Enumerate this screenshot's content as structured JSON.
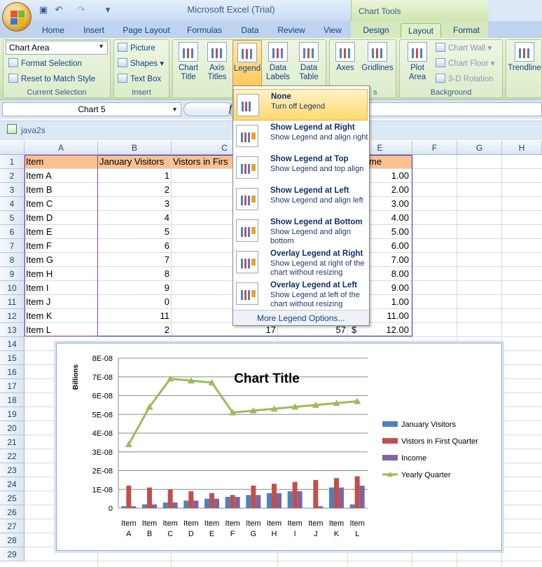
{
  "app": {
    "title": "Microsoft Excel (Trial)",
    "contextual_group": "Chart Tools"
  },
  "tabs": [
    "Home",
    "Insert",
    "Page Layout",
    "Formulas",
    "Data",
    "Review",
    "View",
    "Design",
    "Layout",
    "Format"
  ],
  "active_tab": "Layout",
  "ribbon": {
    "current_selection": {
      "dropdown_value": "Chart Area",
      "format_selection": "Format Selection",
      "reset_style": "Reset to Match Style",
      "label": "Current Selection"
    },
    "insert": {
      "picture": "Picture",
      "shapes": "Shapes",
      "text_box": "Text Box",
      "label": "Insert"
    },
    "labels_group": {
      "chart_title": "Chart Title",
      "axis_titles": "Axis Titles",
      "legend": "Legend",
      "data_labels": "Data Labels",
      "data_table": "Data Table"
    },
    "axes_group": {
      "axes": "Axes",
      "gridlines": "Gridlines",
      "label_tail": "s"
    },
    "background": {
      "plot_area": "Plot Area",
      "chart_wall": "Chart Wall",
      "chart_floor": "Chart Floor",
      "rotation": "3-D Rotation",
      "label": "Background"
    },
    "analysis": {
      "trendline": "Trendline"
    }
  },
  "formula_bar": {
    "name_box": "Chart 5",
    "fx": "f"
  },
  "workbook": {
    "name": "java2s",
    "columns": [
      "A",
      "B",
      "C",
      "D",
      "E",
      "F",
      "G",
      "H"
    ],
    "rows": [
      "1",
      "2",
      "3",
      "4",
      "5",
      "6",
      "7",
      "8",
      "9",
      "10",
      "11",
      "12",
      "13",
      "14",
      "15",
      "16",
      "17",
      "18",
      "19",
      "20",
      "21",
      "22",
      "23",
      "24",
      "25",
      "26",
      "27",
      "28",
      "29"
    ],
    "header": {
      "a": "Item",
      "b": "January Visitors",
      "c": "Vistors in Firs",
      "e": "me"
    },
    "data_rows": [
      {
        "item": "Item A",
        "jan": "1",
        "inc": "1.00"
      },
      {
        "item": "Item B",
        "jan": "2",
        "inc": "2.00"
      },
      {
        "item": "Item C",
        "jan": "3",
        "inc": "3.00"
      },
      {
        "item": "Item D",
        "jan": "4",
        "inc": "4.00"
      },
      {
        "item": "Item E",
        "jan": "5",
        "inc": "5.00"
      },
      {
        "item": "Item F",
        "jan": "6",
        "inc": "6.00"
      },
      {
        "item": "Item G",
        "jan": "7",
        "inc": "7.00"
      },
      {
        "item": "Item H",
        "jan": "8",
        "inc": "8.00"
      },
      {
        "item": "Item I",
        "jan": "9",
        "inc": "9.00"
      },
      {
        "item": "Item J",
        "jan": "0",
        "inc": "1.00"
      },
      {
        "item": "Item K",
        "jan": "11",
        "inc": "11.00"
      },
      {
        "item": "Item L",
        "jan": "2",
        "inc": "12.00"
      }
    ],
    "row13_extra": {
      "c": "17",
      "d": "57",
      "currency": "$"
    }
  },
  "legend_menu": {
    "items": [
      {
        "title": "None",
        "desc": "Turn off Legend"
      },
      {
        "title": "Show Legend at Right",
        "desc": "Show Legend and align right"
      },
      {
        "title": "Show Legend at Top",
        "desc": "Show Legend and top align"
      },
      {
        "title": "Show Legend at Left",
        "desc": "Show Legend and align left"
      },
      {
        "title": "Show Legend at Bottom",
        "desc": "Show Legend and align bottom"
      },
      {
        "title": "Overlay Legend at Right",
        "desc": "Show Legend at right of the chart without resizing"
      },
      {
        "title": "Overlay Legend at Left",
        "desc": "Show Legend at left of the chart without resizing"
      }
    ],
    "more": "More Legend Options..."
  },
  "colors": {
    "jan": "#4f81bd",
    "vis": "#c0504d",
    "inc": "#8064a2",
    "yearly": "#9bbb59"
  },
  "chart_data": {
    "type": "bar",
    "title": "Chart Title",
    "ylabel": "Billions",
    "ylim": [
      0,
      8e-08
    ],
    "yticks": [
      "0",
      "1E-08",
      "2E-08",
      "3E-08",
      "4E-08",
      "5E-08",
      "6E-08",
      "7E-08",
      "8E-08"
    ],
    "categories": [
      [
        "Item",
        "A"
      ],
      [
        "Item",
        "B"
      ],
      [
        "Item",
        "C"
      ],
      [
        "Item",
        "D"
      ],
      [
        "Item",
        "E"
      ],
      [
        "Item",
        "F"
      ],
      [
        "Item",
        "G"
      ],
      [
        "Item",
        "H"
      ],
      [
        "Item",
        "I"
      ],
      [
        "Item",
        "J"
      ],
      [
        "Item",
        "K"
      ],
      [
        "Item",
        "L"
      ]
    ],
    "series": [
      {
        "name": "January Visitors",
        "type": "bar",
        "values": [
          1e-09,
          2e-09,
          3e-09,
          4e-09,
          5e-09,
          6e-09,
          7e-09,
          8e-09,
          9e-09,
          0,
          1.1e-08,
          2e-09
        ]
      },
      {
        "name": "Vistors in First Quarter",
        "type": "bar",
        "values": [
          1.2e-08,
          1.1e-08,
          1e-08,
          9e-09,
          8e-09,
          7e-09,
          1.2e-08,
          1.3e-08,
          1.4e-08,
          1.5e-08,
          1.6e-08,
          1.7e-08
        ]
      },
      {
        "name": "Income",
        "type": "bar",
        "values": [
          1e-09,
          2e-09,
          3e-09,
          4e-09,
          5e-09,
          6e-09,
          7e-09,
          8e-09,
          9e-09,
          1e-09,
          1.1e-08,
          1.2e-08
        ]
      },
      {
        "name": "Yearly Quarter",
        "type": "line",
        "values": [
          3.4e-08,
          5.4e-08,
          6.9e-08,
          6.8e-08,
          6.7e-08,
          5.1e-08,
          5.2e-08,
          5.3e-08,
          5.4e-08,
          5.5e-08,
          5.6e-08,
          5.7e-08
        ]
      }
    ],
    "legend_position": "right",
    "grid": true
  }
}
